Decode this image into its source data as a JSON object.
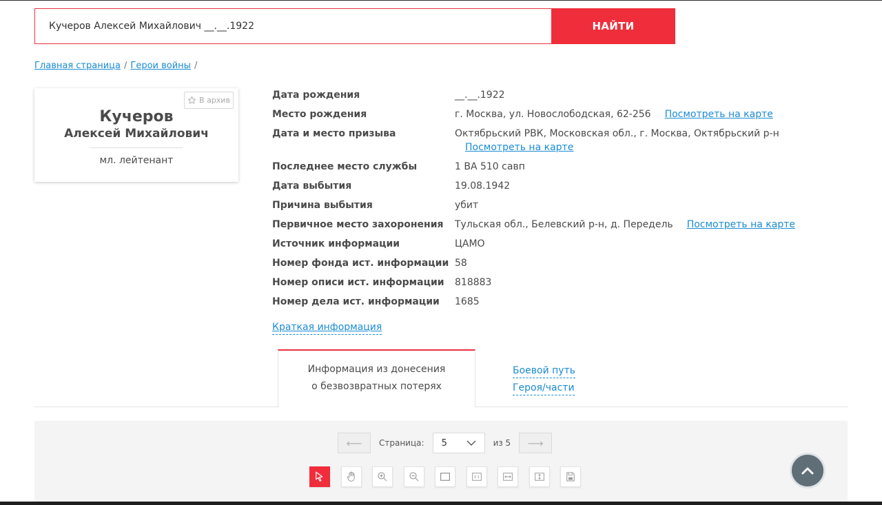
{
  "search": {
    "query": "Кучеров Алексей Михайлович __.__.1922",
    "button_label": "НАЙТИ"
  },
  "breadcrumb": {
    "items": [
      "Главная страница",
      "Герои войны"
    ],
    "separator": "/"
  },
  "person": {
    "last_name": "Кучеров",
    "first_middle": "Алексей Михайлович",
    "rank": "мл. лейтенант",
    "archive_label": "В архив"
  },
  "info": {
    "birth_date": {
      "label": "Дата рождения",
      "value": "__.__.1922"
    },
    "birth_place": {
      "label": "Место рождения",
      "value": "г. Москва, ул. Новослободская, 62-256",
      "link": "Посмотреть на карте"
    },
    "draft": {
      "label": "Дата и место призыва",
      "value": "Октябрьский РВК, Московская обл., г. Москва, Октябрьский р-н",
      "link": "Посмотреть на карте"
    },
    "last_service": {
      "label": "Последнее место службы",
      "value": "1 ВА 510 савп"
    },
    "leave_date": {
      "label": "Дата выбытия",
      "value": "19.08.1942"
    },
    "leave_reason": {
      "label": "Причина выбытия",
      "value": "убит"
    },
    "burial": {
      "label": "Первичное место захоронения",
      "value": "Тульская обл., Белевский р-н, д. Передель",
      "link": "Посмотреть на карте"
    },
    "source": {
      "label": "Источник информации",
      "value": "ЦАМО"
    },
    "fund": {
      "label": "Номер фонда ист. информации",
      "value": "58"
    },
    "inventory": {
      "label": "Номер описи ист. информации",
      "value": "818883"
    },
    "case": {
      "label": "Номер дела ист. информации",
      "value": "1685"
    }
  },
  "short_info_label": "Краткая информация",
  "tabs": {
    "active_line1": "Информация из донесения",
    "active_line2": "о безвозвратных потерях",
    "link_line1": "Боевой путь",
    "link_line2": "Героя/части"
  },
  "viewer": {
    "page_label": "Страница:",
    "current_page": "5",
    "total_label": "из 5",
    "prev_arrow": "⟵",
    "next_arrow": "⟶"
  },
  "colors": {
    "accent": "#f02d3a",
    "link": "#1a8bd6",
    "text": "#4a4a4a"
  }
}
